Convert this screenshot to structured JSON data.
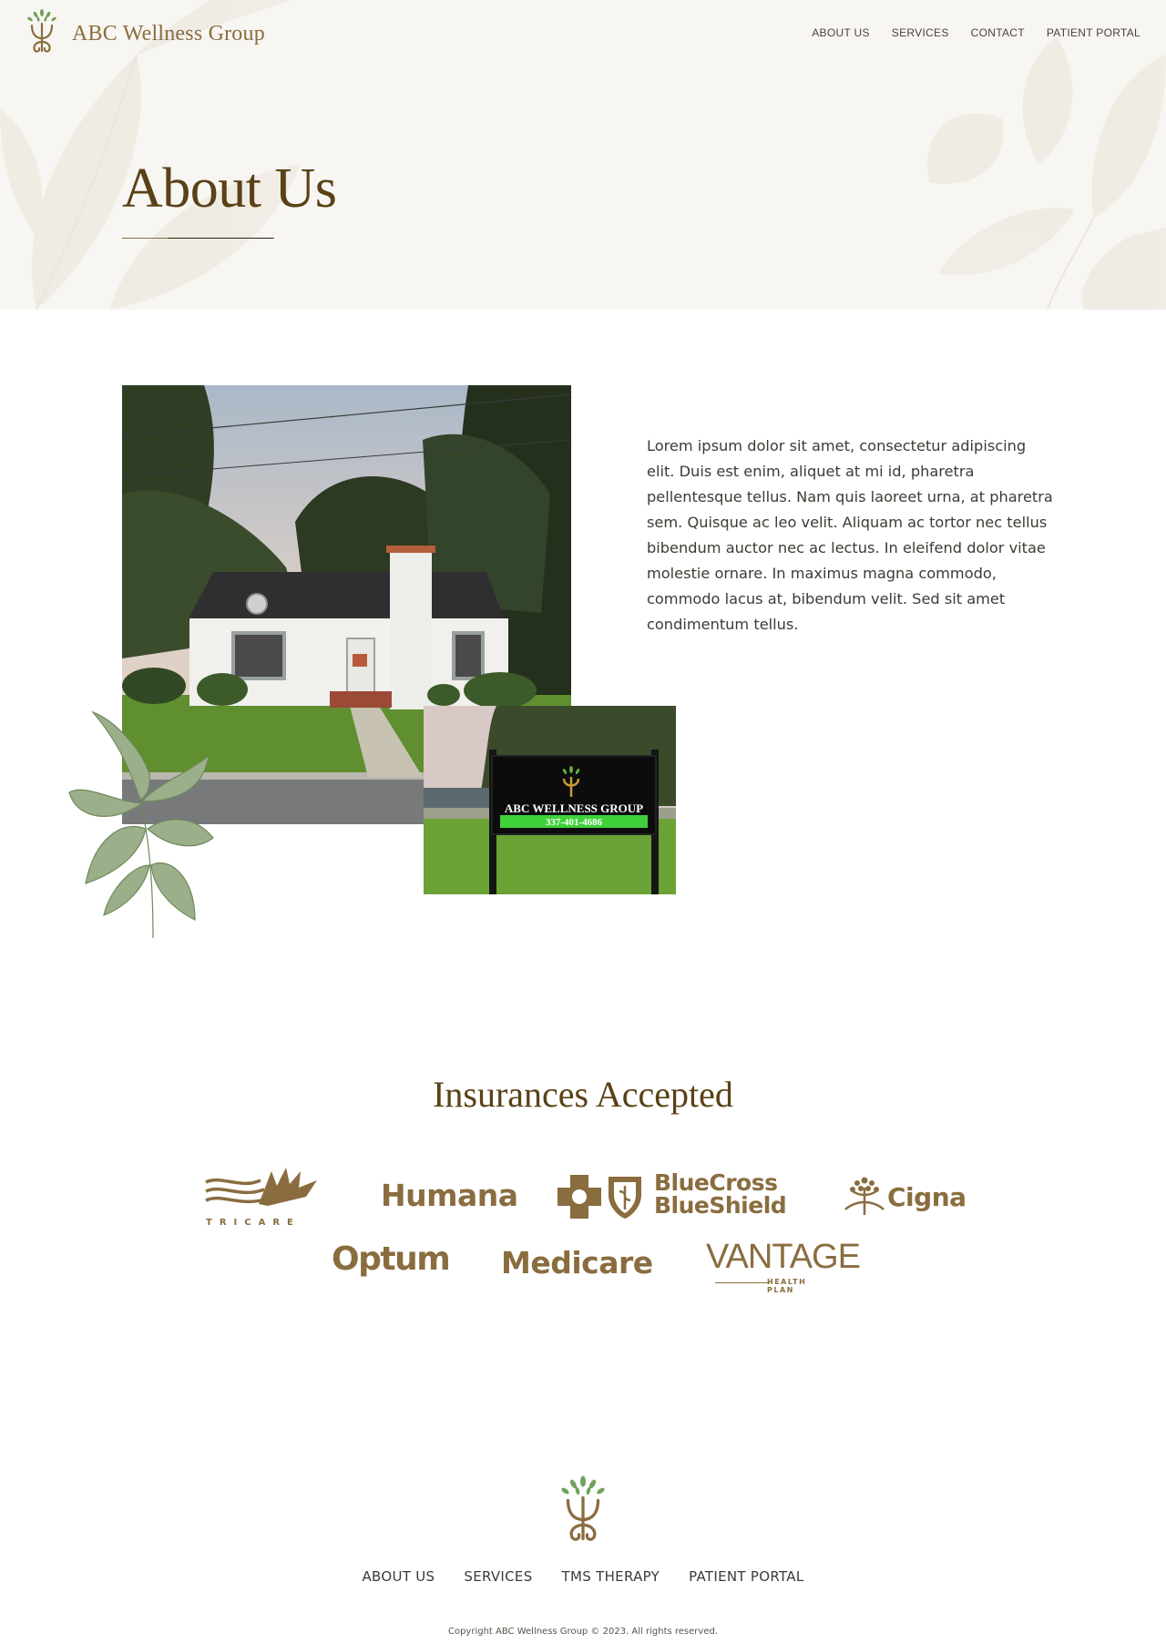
{
  "brand": {
    "name": "ABC Wellness Group"
  },
  "nav": {
    "about": "ABOUT US",
    "services": "SERVICES",
    "contact": "CONTACT",
    "portal": "PATIENT PORTAL"
  },
  "hero": {
    "title": "About Us"
  },
  "about": {
    "body": "Lorem ipsum dolor sit amet, consectetur adipiscing elit. Duis est enim, aliquet at mi id, pharetra pellentesque tellus. Nam quis laoreet urna, at pharetra sem. Quisque ac leo velit. Aliquam ac tortor nec tellus bibendum auctor nec ac lectus. In eleifend dolor vitae molestie ornare. In maximus magna commodo, commodo lacus at, bibendum velit. Sed sit amet condimentum tellus.",
    "sign_name": "ABC WELLNESS GROUP",
    "sign_phone": "337-401-4686"
  },
  "insurance": {
    "title": "Insurances Accepted",
    "logos": {
      "tricare": "TRICARE",
      "humana": "Humana",
      "bcbs_line1": "BlueCross",
      "bcbs_line2": "BlueShield",
      "cigna": "Cigna",
      "optum": "Optum",
      "medicare": "Medicare",
      "vantage": "VANTAGE",
      "vantage_sub": "HEALTH PLAN"
    }
  },
  "footer": {
    "nav": {
      "about": "ABOUT US",
      "services": "SERVICES",
      "tms": "TMS THERAPY",
      "portal": "PATIENT PORTAL"
    },
    "copyright": "Copyright ABC Wellness Group © 2023. All rights reserved."
  },
  "colors": {
    "brand_gold": "#8a6d3f",
    "title_brown": "#5a4116",
    "hero_bg": "#f8f6f2",
    "leaf_green": "#6fa25a",
    "plant_green": "#9aaf8a"
  }
}
